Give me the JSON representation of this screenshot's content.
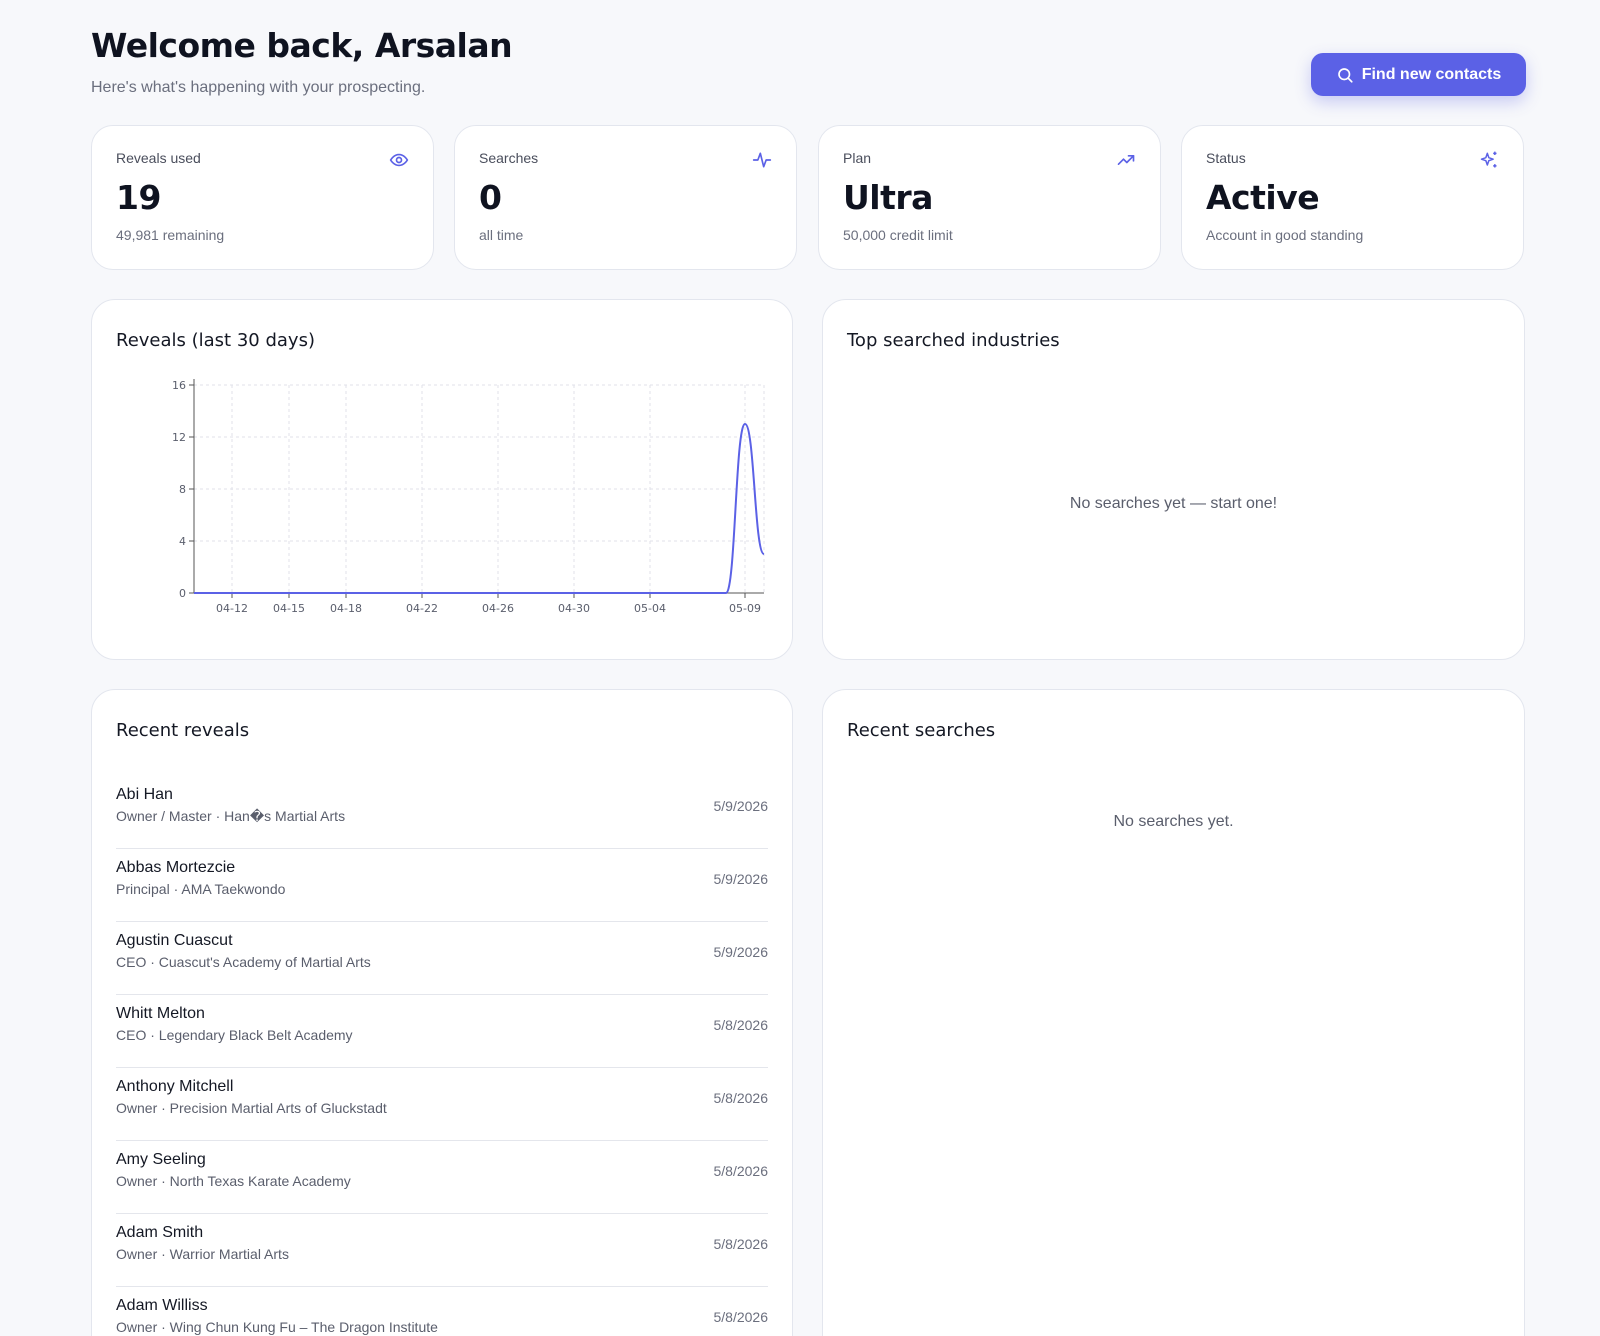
{
  "header": {
    "title": "Welcome back, Arsalan",
    "subtitle": "Here's what's happening with your prospecting."
  },
  "cta": {
    "label": "Find new contacts",
    "icon": "search-icon"
  },
  "stats": [
    {
      "label": "Reveals used",
      "value": "19",
      "sub": "49,981 remaining",
      "icon": "eye-icon"
    },
    {
      "label": "Searches",
      "value": "0",
      "sub": "all time",
      "icon": "activity-icon"
    },
    {
      "label": "Plan",
      "value": "Ultra",
      "sub": "50,000 credit limit",
      "icon": "trending-up-icon"
    },
    {
      "label": "Status",
      "value": "Active",
      "sub": "Account in good standing",
      "icon": "sparkles-icon"
    }
  ],
  "colors": {
    "accent": "#5b61e6",
    "line": "#5b61e6",
    "grid": "#e0e2ea"
  },
  "reveals_chart": {
    "title": "Reveals (last 30 days)"
  },
  "chart_data": {
    "type": "line",
    "title": "Reveals (last 30 days)",
    "xlabel": "",
    "ylabel": "",
    "ylim": [
      0,
      16
    ],
    "yticks": [
      0,
      4,
      8,
      12,
      16
    ],
    "xticks": [
      "04-12",
      "04-15",
      "04-18",
      "04-22",
      "04-26",
      "04-30",
      "05-04",
      "05-09"
    ],
    "grid": true,
    "x": [
      "04-10",
      "04-11",
      "04-12",
      "04-13",
      "04-14",
      "04-15",
      "04-16",
      "04-17",
      "04-18",
      "04-19",
      "04-20",
      "04-21",
      "04-22",
      "04-23",
      "04-24",
      "04-25",
      "04-26",
      "04-27",
      "04-28",
      "04-29",
      "04-30",
      "05-01",
      "05-02",
      "05-03",
      "05-04",
      "05-05",
      "05-06",
      "05-07",
      "05-08",
      "05-09",
      "05-10"
    ],
    "series": [
      {
        "values": [
          0,
          0,
          0,
          0,
          0,
          0,
          0,
          0,
          0,
          0,
          0,
          0,
          0,
          0,
          0,
          0,
          0,
          0,
          0,
          0,
          0,
          0,
          0,
          0,
          0,
          0,
          0,
          0,
          0,
          13,
          3
        ]
      }
    ]
  },
  "industries": {
    "title": "Top searched industries",
    "empty": "No searches yet — start one!"
  },
  "recent_reveals": {
    "title": "Recent reveals",
    "items": [
      {
        "name": "Abi Han",
        "meta": "Owner / Master · Han�s Martial Arts",
        "date": "5/9/2026"
      },
      {
        "name": "Abbas Mortezcie",
        "meta": "Principal · AMA Taekwondo",
        "date": "5/9/2026"
      },
      {
        "name": "Agustin Cuascut",
        "meta": "CEO · Cuascut's Academy of Martial Arts",
        "date": "5/9/2026"
      },
      {
        "name": "Whitt Melton",
        "meta": "CEO · Legendary Black Belt Academy",
        "date": "5/8/2026"
      },
      {
        "name": "Anthony Mitchell",
        "meta": "Owner · Precision Martial Arts of Gluckstadt",
        "date": "5/8/2026"
      },
      {
        "name": "Amy Seeling",
        "meta": "Owner · North Texas Karate Academy",
        "date": "5/8/2026"
      },
      {
        "name": "Adam Smith",
        "meta": "Owner · Warrior Martial Arts",
        "date": "5/8/2026"
      },
      {
        "name": "Adam Williss",
        "meta": "Owner · Wing Chun Kung Fu – The Dragon Institute",
        "date": "5/8/2026"
      }
    ]
  },
  "recent_searches": {
    "title": "Recent searches",
    "empty": "No searches yet."
  }
}
